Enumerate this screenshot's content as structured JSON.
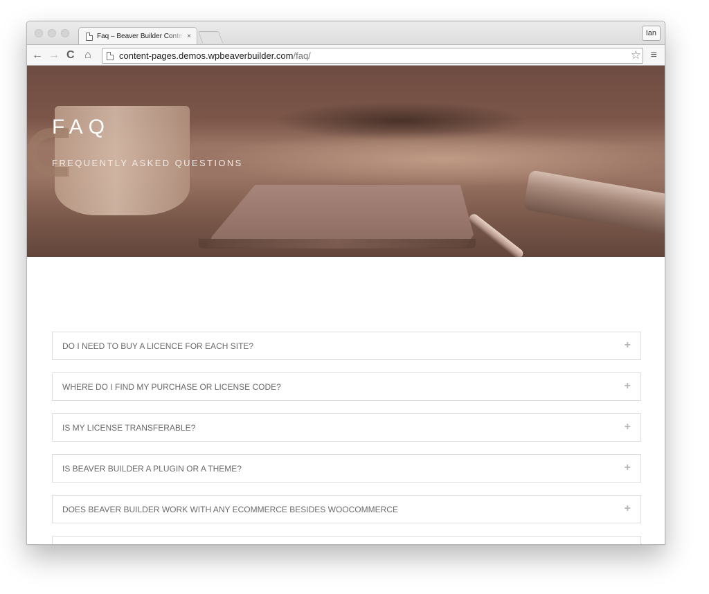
{
  "browser": {
    "tab_title": "Faq – Beaver Builder Conte",
    "tab_close": "×",
    "profile_name": "Ian",
    "url_host": "content-pages.demos.wpbeaverbuilder.com",
    "url_path": "/faq/",
    "icons": {
      "back": "←",
      "forward": "→",
      "reload": "C",
      "home": "⌂",
      "star": "☆",
      "menu": "≡"
    }
  },
  "hero": {
    "title": "FAQ",
    "subtitle": "FREQUENTLY ASKED QUESTIONS"
  },
  "faq": {
    "expand_glyph": "+",
    "items": [
      {
        "question": "DO I NEED TO BUY A LICENCE FOR EACH SITE?"
      },
      {
        "question": "WHERE DO I FIND MY PURCHASE OR LICENSE CODE?"
      },
      {
        "question": "IS MY LICENSE TRANSFERABLE?"
      },
      {
        "question": "IS BEAVER BUILDER A PLUGIN OR A THEME?"
      },
      {
        "question": "DOES BEAVER BUILDER WORK WITH ANY ECOMMERCE BESIDES WOOCOMMERCE"
      },
      {
        "question": ""
      }
    ]
  }
}
